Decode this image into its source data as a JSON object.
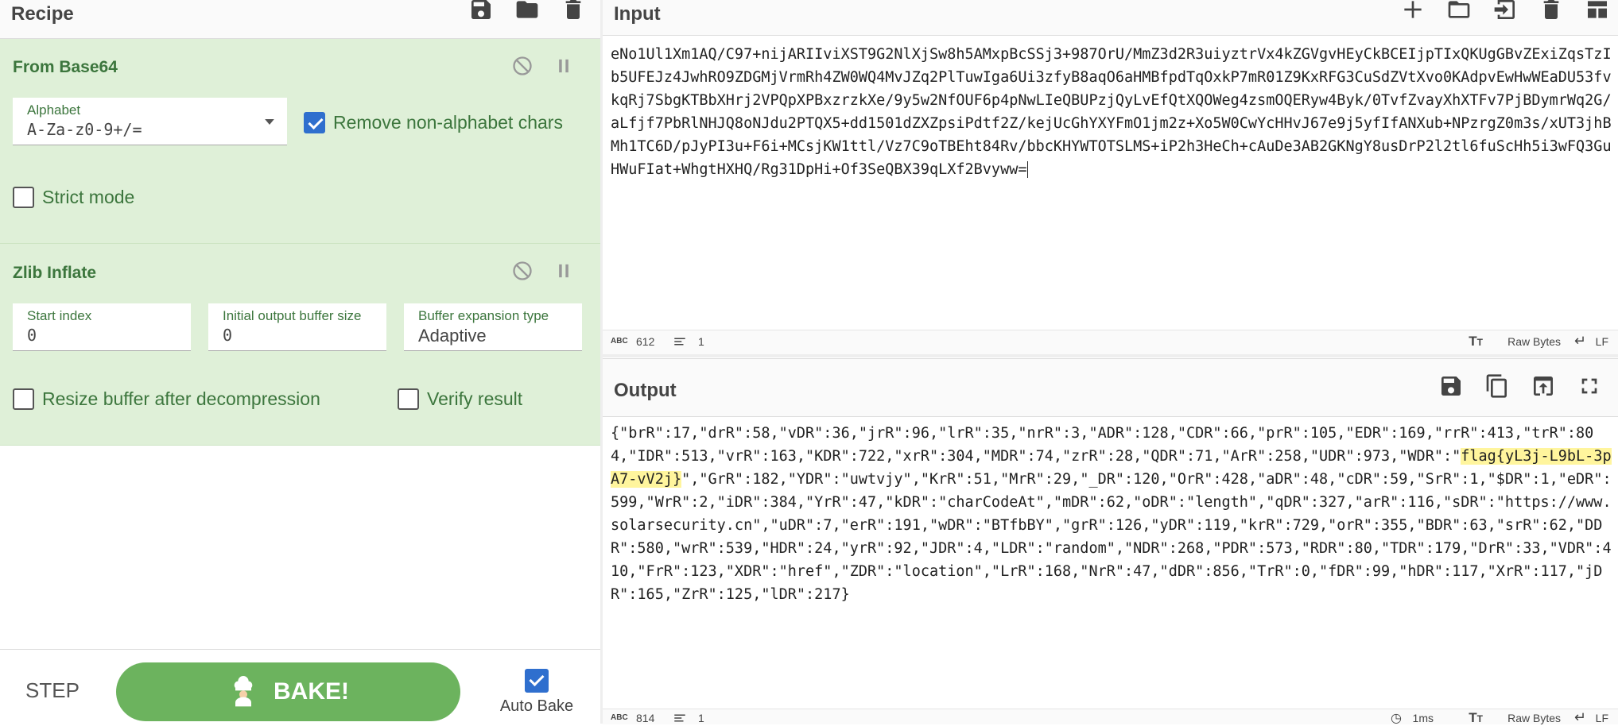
{
  "recipe": {
    "title": "Recipe",
    "ops": [
      {
        "name": "From Base64",
        "alphabet_label": "Alphabet",
        "alphabet_value": "A-Za-z0-9+/=",
        "remove_nonalpha_label": "Remove non-alphabet chars",
        "remove_nonalpha_checked": true,
        "strict_label": "Strict mode",
        "strict_checked": false
      },
      {
        "name": "Zlib Inflate",
        "start_index_label": "Start index",
        "start_index_value": "0",
        "init_buffer_label": "Initial output buffer size",
        "init_buffer_value": "0",
        "expansion_label": "Buffer expansion type",
        "expansion_value": "Adaptive",
        "resize_label": "Resize buffer after decompression",
        "verify_label": "Verify result"
      }
    ],
    "step_label": "STEP",
    "bake_label": "BAKE!",
    "autobake_label": "Auto Bake"
  },
  "input": {
    "title": "Input",
    "text": "eNo1Ul1Xm1AQ/C97+nijARIIviXST9G2NlXjSw8h5AMxpBcSSj3+987OrU/MmZ3d2R3uiyztrVx4kZGVgvHEyCkBCEIjpTIxQKUgGBvZExiZqsTzIb5UFEJz4JwhRO9ZDGMjVrmRh4ZW0WQ4MvJZq2PlTuwIga6Ui3zfyB8aqO6aHMBfpdTqOxkP7mR01Z9KxRFG3CuSdZVtXvo0KAdpvEwHwWEaDU53fvkqRj7SbgKTBbXHrj2VPQpXPBxzrzkXe/9y5w2NfOUF6p4pNwLIeQBUPzjQyLvEfQtXQOWeg4zsmOQERyw4Byk/0TvfZvayXhXTFv7PjBDymrWq2G/aLfjf7PbRlNHJQ8oNJdu2PTQX5+dd1501dZXZpsiPdtf2Z/kejUcGhYXYFmO1jm2z+Xo5W0CwYcHHvJ67e9j5yfIfANXub+NPzrgZ0m3s/xUT3jhBMh1TC6D/pJyPI3u+F6i+MCsjKW1ttl/Vz7C9oTBEht84Rv/bbcKHYWTOTSLMS+iP2h3HeCh+cAuDe3AB2GKNgY8usDrP2l2tl6fuScHh5i3wFQ3GuHWuFIat+WhgtHXHQ/Rg31DpHi+Of3SeQBX39qLXf2Bvyww=",
    "char_count": "612",
    "line_count": "1",
    "raw_bytes": "Raw Bytes",
    "eol": "LF"
  },
  "output": {
    "title": "Output",
    "text_before": "{\"brR\":17,\"drR\":58,\"vDR\":36,\"jrR\":96,\"lrR\":35,\"nrR\":3,\"ADR\":128,\"CDR\":66,\"prR\":105,\"EDR\":169,\"rrR\":413,\"trR\":804,\"IDR\":513,\"vrR\":163,\"KDR\":722,\"xrR\":304,\"MDR\":74,\"zrR\":28,\"QDR\":71,\"ArR\":258,\"UDR\":973,\"WDR\":\"",
    "flag": "flag{yL3j-L9bL-3pA7-vV2j}",
    "text_after": "\",\"GrR\":182,\"YDR\":\"uwtvjy\",\"KrR\":51,\"MrR\":29,\"_DR\":120,\"OrR\":428,\"aDR\":48,\"cDR\":59,\"SrR\":1,\"$DR\":1,\"eDR\":599,\"WrR\":2,\"iDR\":384,\"YrR\":47,\"kDR\":\"charCodeAt\",\"mDR\":62,\"oDR\":\"length\",\"qDR\":327,\"arR\":116,\"sDR\":\"https://www.solarsecurity.cn\",\"uDR\":7,\"erR\":191,\"wDR\":\"BTfbBY\",\"grR\":126,\"yDR\":119,\"krR\":729,\"orR\":355,\"BDR\":63,\"srR\":62,\"DDR\":580,\"wrR\":539,\"HDR\":24,\"yrR\":92,\"JDR\":4,\"LDR\":\"random\",\"NDR\":268,\"PDR\":573,\"RDR\":80,\"TDR\":179,\"DrR\":33,\"VDR\":410,\"FrR\":123,\"XDR\":\"href\",\"ZDR\":\"location\",\"LrR\":168,\"NrR\":47,\"dDR\":856,\"TrR\":0,\"fDR\":99,\"hDR\":117,\"XrR\":117,\"jDR\":165,\"ZrR\":125,\"lDR\":217}",
    "char_count": "814",
    "line_count": "1",
    "time": "1ms",
    "raw_bytes": "Raw Bytes",
    "eol": "LF"
  }
}
